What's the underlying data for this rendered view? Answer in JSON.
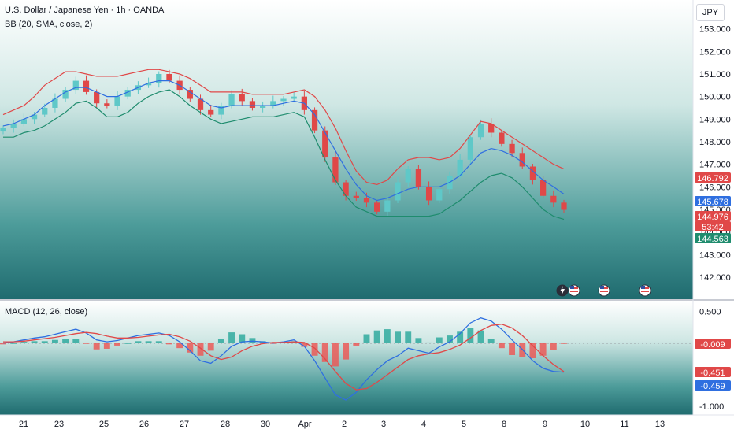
{
  "header": {
    "title": "U.S. Dollar / Japanese Yen · 1h · OANDA",
    "bb_label": "BB (20, SMA, close, 2)",
    "currency": "JPY"
  },
  "macd_label": "MACD (12, 26, close)",
  "colors": {
    "up": "#5fc8c8",
    "down": "#e04848",
    "upper_band": "#e04848",
    "basis": "#2f6fe0",
    "lower_band": "#1f8c6e",
    "macd_line": "#2f6fe0",
    "signal_line": "#e04848",
    "hist_pos": "#26a69a",
    "hist_neg": "#ef5350"
  },
  "price_labels": [
    {
      "text": "146.792",
      "bg": "#e04848"
    },
    {
      "text": "145.678",
      "bg": "#2f6fe0"
    },
    {
      "text": "144.976",
      "bg": "#e04848"
    },
    {
      "text": "53:42",
      "bg": "#e04848"
    },
    {
      "text": "144.563",
      "bg": "#1f8c6e"
    }
  ],
  "macd_labels": [
    {
      "text": "-0.009",
      "bg": "#e04848"
    },
    {
      "text": "-0.451",
      "bg": "#e04848"
    },
    {
      "text": "-0.459",
      "bg": "#2f6fe0"
    }
  ],
  "chart_data": [
    {
      "type": "candlestick",
      "title": "U.S. Dollar / Japanese Yen · 1h · OANDA",
      "ylim": [
        141.3,
        154.0
      ],
      "y_ticks": [
        "142.000",
        "143.000",
        "144.000",
        "145.000",
        "146.000",
        "147.000",
        "148.000",
        "149.000",
        "150.000",
        "151.000",
        "152.000",
        "153.000"
      ],
      "x_ticks": [
        "21",
        "23",
        "25",
        "26",
        "27",
        "28",
        "30",
        "Apr",
        "2",
        "3",
        "4",
        "5",
        "8",
        "9",
        "10",
        "11",
        "13"
      ],
      "series": [
        {
          "name": "Price (close)",
          "values": [
            148.6,
            148.8,
            149.0,
            149.2,
            149.5,
            149.9,
            150.3,
            150.7,
            150.2,
            149.7,
            149.6,
            150.0,
            150.3,
            150.5,
            150.6,
            151.0,
            150.7,
            150.3,
            149.9,
            149.4,
            149.2,
            149.6,
            150.1,
            149.8,
            149.5,
            149.6,
            149.8,
            149.9,
            150.0,
            149.4,
            148.5,
            147.3,
            146.2,
            145.6,
            145.5,
            145.3,
            144.9,
            145.4,
            146.2,
            146.8,
            146.0,
            145.4,
            145.9,
            146.5,
            147.2,
            148.2,
            148.8,
            148.4,
            147.9,
            147.5,
            146.9,
            146.3,
            145.6,
            145.3,
            144.98
          ]
        },
        {
          "name": "BB upper",
          "values": [
            149.2,
            149.4,
            149.6,
            150.0,
            150.5,
            150.8,
            151.1,
            151.1,
            151.0,
            150.9,
            150.9,
            150.9,
            151.0,
            151.1,
            151.2,
            151.2,
            151.1,
            151.0,
            150.8,
            150.5,
            150.2,
            150.2,
            150.2,
            150.2,
            150.1,
            150.1,
            150.1,
            150.1,
            150.2,
            150.3,
            150.0,
            149.4,
            148.6,
            147.6,
            146.7,
            146.2,
            146.1,
            146.3,
            146.8,
            147.2,
            147.3,
            147.3,
            147.2,
            147.3,
            147.7,
            148.3,
            148.9,
            148.8,
            148.5,
            148.2,
            147.9,
            147.6,
            147.3,
            147.0,
            146.79
          ]
        },
        {
          "name": "BB basis",
          "values": [
            148.7,
            148.8,
            149.0,
            149.2,
            149.6,
            149.9,
            150.2,
            150.4,
            150.4,
            150.2,
            150.0,
            150.0,
            150.2,
            150.4,
            150.6,
            150.7,
            150.7,
            150.5,
            150.2,
            149.9,
            149.6,
            149.5,
            149.6,
            149.6,
            149.6,
            149.6,
            149.6,
            149.7,
            149.8,
            149.7,
            149.2,
            148.4,
            147.6,
            146.8,
            146.1,
            145.6,
            145.4,
            145.5,
            145.7,
            145.9,
            146.0,
            146.0,
            146.0,
            146.2,
            146.5,
            147.0,
            147.5,
            147.7,
            147.6,
            147.4,
            147.1,
            146.7,
            146.3,
            146.0,
            145.68
          ]
        },
        {
          "name": "BB lower",
          "values": [
            148.2,
            148.2,
            148.4,
            148.5,
            148.7,
            149.0,
            149.3,
            149.7,
            149.8,
            149.5,
            149.1,
            149.1,
            149.3,
            149.7,
            150.0,
            150.2,
            150.3,
            150.0,
            149.6,
            149.3,
            149.0,
            148.8,
            148.9,
            149.0,
            149.1,
            149.1,
            149.1,
            149.2,
            149.3,
            149.1,
            148.2,
            147.2,
            146.3,
            145.6,
            145.1,
            144.9,
            144.7,
            144.7,
            144.7,
            144.7,
            144.7,
            144.7,
            144.8,
            145.1,
            145.4,
            145.8,
            146.2,
            146.5,
            146.6,
            146.4,
            146.0,
            145.5,
            145.0,
            144.7,
            144.56
          ]
        }
      ]
    },
    {
      "type": "line",
      "title": "MACD (12, 26, close)",
      "ylim": [
        -1.1,
        0.62
      ],
      "y_ticks": [
        "0.500",
        "-1.000"
      ],
      "series": [
        {
          "name": "MACD",
          "values": [
            0.0,
            0.02,
            0.05,
            0.08,
            0.1,
            0.14,
            0.18,
            0.22,
            0.16,
            0.05,
            0.02,
            0.04,
            0.08,
            0.12,
            0.14,
            0.16,
            0.12,
            0.02,
            -0.12,
            -0.28,
            -0.32,
            -0.2,
            -0.05,
            0.02,
            0.03,
            0.02,
            0.0,
            0.02,
            0.05,
            -0.05,
            -0.28,
            -0.55,
            -0.82,
            -0.9,
            -0.78,
            -0.58,
            -0.42,
            -0.28,
            -0.2,
            -0.08,
            -0.12,
            -0.16,
            -0.06,
            0.02,
            0.15,
            0.32,
            0.4,
            0.35,
            0.22,
            0.05,
            -0.1,
            -0.28,
            -0.4,
            -0.45,
            -0.459
          ]
        },
        {
          "name": "Signal",
          "values": [
            0.02,
            0.02,
            0.03,
            0.05,
            0.07,
            0.09,
            0.12,
            0.15,
            0.17,
            0.15,
            0.11,
            0.08,
            0.08,
            0.09,
            0.11,
            0.13,
            0.14,
            0.1,
            0.03,
            -0.08,
            -0.2,
            -0.26,
            -0.22,
            -0.12,
            -0.05,
            -0.01,
            0.01,
            0.01,
            0.02,
            0.01,
            -0.08,
            -0.25,
            -0.45,
            -0.64,
            -0.74,
            -0.72,
            -0.62,
            -0.5,
            -0.38,
            -0.26,
            -0.2,
            -0.17,
            -0.15,
            -0.1,
            -0.03,
            0.08,
            0.2,
            0.28,
            0.3,
            0.24,
            0.12,
            -0.04,
            -0.2,
            -0.34,
            -0.451
          ]
        },
        {
          "name": "Histogram",
          "values": [
            -0.02,
            0.0,
            0.02,
            0.03,
            0.03,
            0.05,
            0.06,
            0.07,
            -0.01,
            -0.1,
            -0.09,
            -0.04,
            0.0,
            0.03,
            0.03,
            0.03,
            -0.02,
            -0.08,
            -0.15,
            -0.2,
            -0.12,
            0.06,
            0.17,
            0.14,
            0.08,
            0.03,
            -0.01,
            0.01,
            0.03,
            -0.06,
            -0.2,
            -0.3,
            -0.37,
            -0.26,
            -0.04,
            0.14,
            0.2,
            0.22,
            0.18,
            0.18,
            0.08,
            0.01,
            0.09,
            0.12,
            0.18,
            0.24,
            0.2,
            0.07,
            -0.08,
            -0.19,
            -0.22,
            -0.24,
            -0.2,
            -0.11,
            -0.009
          ]
        }
      ]
    }
  ]
}
